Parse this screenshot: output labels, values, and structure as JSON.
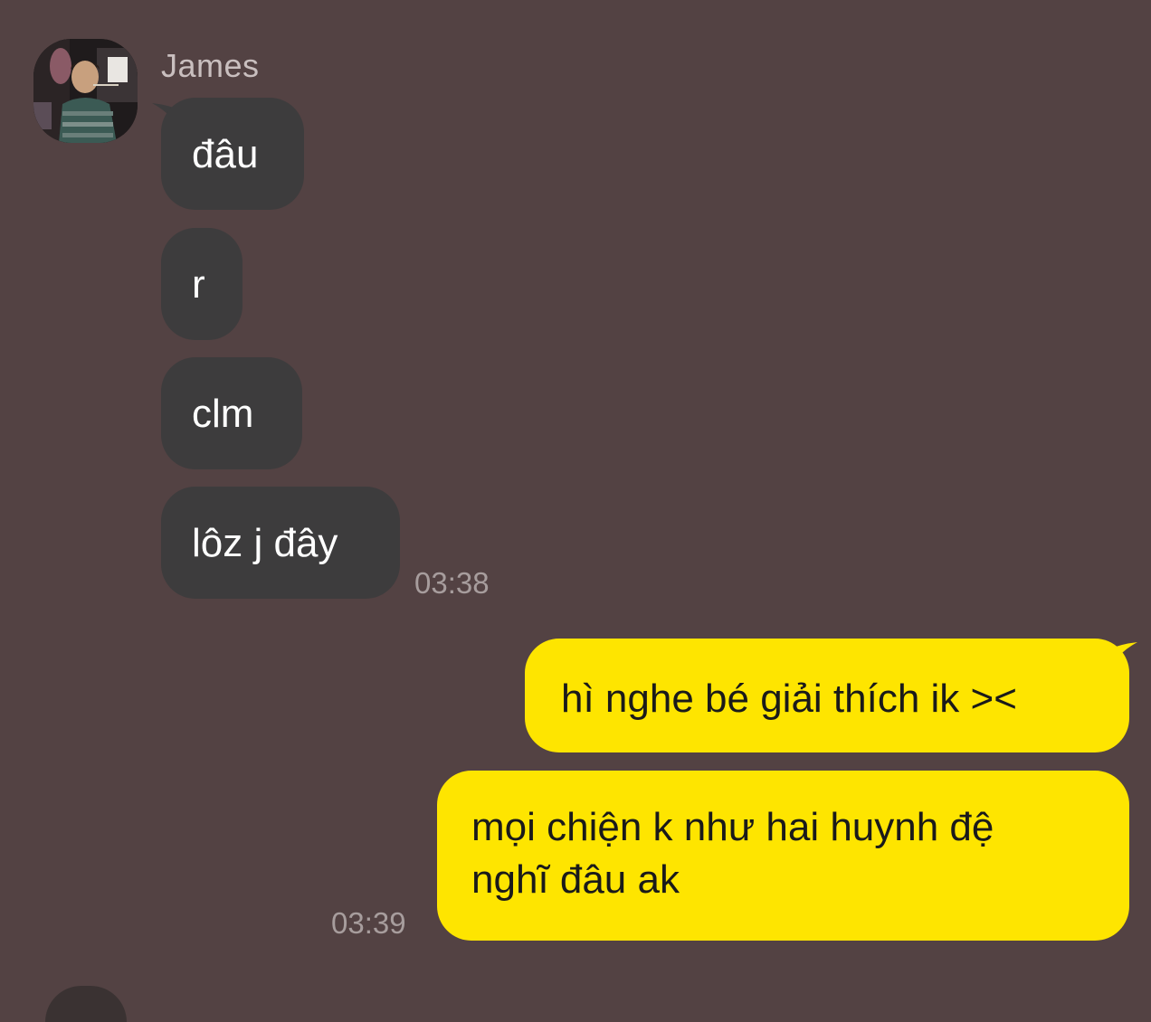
{
  "conversation": {
    "sender_name": "James",
    "incoming": [
      {
        "text": "đâu"
      },
      {
        "text": "r"
      },
      {
        "text": "clm"
      },
      {
        "text": "lôz j đây"
      }
    ],
    "incoming_time": "03:38",
    "outgoing": [
      {
        "text": "hì nghe bé giải thích ik ><"
      },
      {
        "line1": "mọi chiện k như hai huynh đệ",
        "line2": "nghĩ đâu ak"
      }
    ],
    "outgoing_time": "03:39"
  },
  "colors": {
    "background": "#534243",
    "incoming_bubble": "#3d3c3d",
    "outgoing_bubble": "#fee500",
    "incoming_text": "#ffffff",
    "outgoing_text": "#1a1a1a",
    "time_text": "#a79d9d"
  },
  "icons": {
    "avatar": "profile-photo"
  }
}
